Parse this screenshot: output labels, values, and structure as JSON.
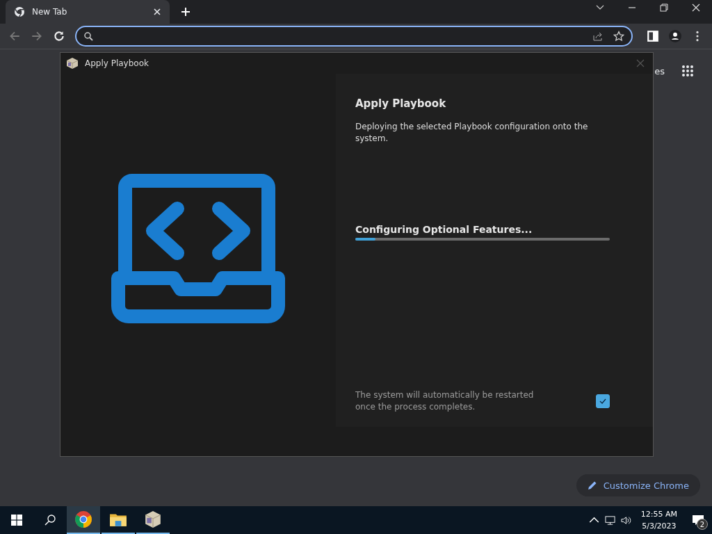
{
  "browser": {
    "tabs": [
      {
        "label": "New Tab",
        "selected": true
      }
    ]
  },
  "new_tab_page": {
    "shortcut_label": "es",
    "customize_button": "Customize Chrome"
  },
  "dialog": {
    "title": "Apply Playbook",
    "heading": "Apply Playbook",
    "description": "Deploying the selected Playbook configuration onto the system.",
    "progress": {
      "label": "Configuring Optional Features...",
      "level": 0.08
    },
    "restart_note": "The system will automatically be restarted once the process completes.",
    "restart_checked": true
  },
  "taskbar": {
    "apps": [
      {
        "kind": "chrome",
        "selected": true
      },
      {
        "kind": "folder",
        "selected": false
      },
      {
        "kind": "box",
        "selected": false
      }
    ],
    "time": "12:55 AM",
    "date": "5/3/2023",
    "notifications": "2"
  }
}
